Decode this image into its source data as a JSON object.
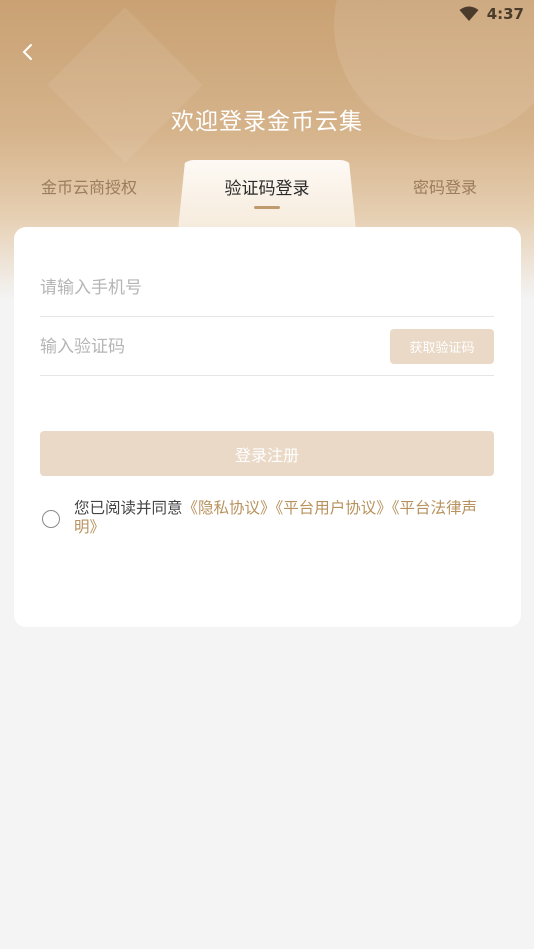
{
  "status_bar": {
    "time": "4:37"
  },
  "header": {
    "title": "欢迎登录金币云集"
  },
  "tabs": [
    {
      "label": "金币云商授权"
    },
    {
      "label": "验证码登录"
    },
    {
      "label": "密码登录"
    }
  ],
  "form": {
    "phone_placeholder": "请输入手机号",
    "phone_value": "",
    "code_placeholder": "输入验证码",
    "code_value": "",
    "get_code_label": "获取验证码",
    "login_label": "登录注册"
  },
  "agreement": {
    "prefix": "您已阅读并同意",
    "privacy": "《隐私协议》",
    "user": "《平台用户协议》",
    "legal": "《平台法律声明》"
  },
  "colors": {
    "accent": "#c09a6f",
    "link": "#b8925e",
    "button_disabled": "#ead9c6"
  }
}
